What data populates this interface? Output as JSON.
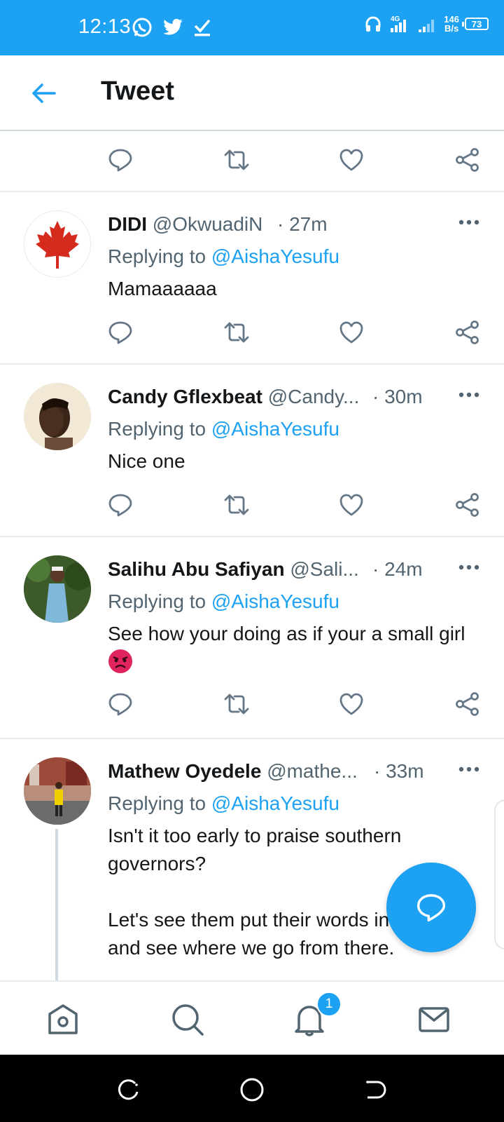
{
  "status_bar": {
    "time": "12:13",
    "net_speed_value": "146",
    "net_speed_unit": "B/s",
    "battery": "73",
    "network": "4G"
  },
  "header": {
    "title": "Tweet"
  },
  "tweets": [
    {
      "name": "DIDI",
      "handle": "@OkwuadiN",
      "time": "· 27m",
      "replying_prefix": "Replying to ",
      "replying_to": "@AishaYesufu",
      "text": "Mamaaaaaa"
    },
    {
      "name": "Candy Gflexbeat",
      "handle": "@Candy...",
      "time": "· 30m",
      "replying_prefix": "Replying to ",
      "replying_to": "@AishaYesufu",
      "text": "Nice one"
    },
    {
      "name": "Salihu Abu Safiyan",
      "handle": "@Sali...",
      "time": "· 24m",
      "replying_prefix": "Replying to ",
      "replying_to": "@AishaYesufu",
      "text": "See how your doing as if your a small girl"
    },
    {
      "name": "Mathew Oyedele",
      "handle": "@mathe...",
      "time": "· 33m",
      "replying_prefix": "Replying to ",
      "replying_to": "@AishaYesufu",
      "text_line1": "Isn't it too early to praise southern governors?",
      "text_line2": "Let's see them put their words into action and see where we go from there."
    }
  ],
  "bottom_nav": {
    "notifications_badge": "1"
  },
  "colors": {
    "accent": "#1da1f2",
    "text": "#14171a",
    "secondary": "#536471"
  }
}
